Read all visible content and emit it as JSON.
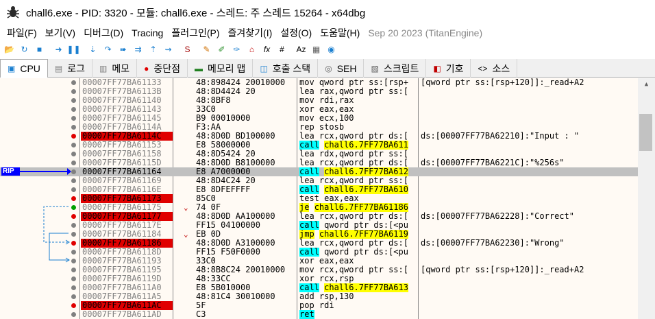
{
  "window": {
    "title": "chall6.exe - PID: 3320 - 모듈: chall6.exe - 스레드: 주 스레드 15264 - x64dbg"
  },
  "menu": [
    "파일(F)",
    "보기(V)",
    "디버그(D)",
    "Tracing",
    "플러그인(P)",
    "즐겨찾기(I)",
    "설정(O)",
    "도움말(H)"
  ],
  "build": "Sep 20 2023 (TitanEngine)",
  "toolbar_icons": [
    "open-icon",
    "restart-icon",
    "stop-icon",
    "run-icon",
    "pause-icon",
    "step-into-icon",
    "step-over-icon",
    "trace-into-icon",
    "trace-over-icon",
    "execute-till-return-icon",
    "run-to-user-code-icon",
    "scylla-icon",
    "patch-icon",
    "comment-icon",
    "label-icon",
    "bookmark-icon",
    "function-icon",
    "hash-icon",
    "strings-icon",
    "calculator-icon",
    "globe-icon"
  ],
  "tabs": [
    {
      "label": "CPU",
      "icon": "cpu-icon"
    },
    {
      "label": "로그",
      "icon": "log-icon"
    },
    {
      "label": "메모",
      "icon": "notes-icon"
    },
    {
      "label": "중단점",
      "icon": "breakpoint-icon"
    },
    {
      "label": "메모리 맵",
      "icon": "memory-map-icon"
    },
    {
      "label": "호출 스택",
      "icon": "call-stack-icon"
    },
    {
      "label": "SEH",
      "icon": "seh-icon"
    },
    {
      "label": "스크립트",
      "icon": "script-icon"
    },
    {
      "label": "기호",
      "icon": "symbols-icon"
    },
    {
      "label": "소스",
      "icon": "source-icon"
    }
  ],
  "rip_label": "RIP",
  "colors": {
    "breakpoint": "#e00000",
    "rip_row": "#c0c0c0",
    "call_highlight": "#00ffff",
    "jump_highlight": "#ffff00"
  },
  "rows": [
    {
      "addr": "00007FF77BA61133",
      "bytes": "48:898424 20010000",
      "mn": "mov",
      "ops": "qword ptr ss:[rsp+",
      "comment": "[qword ptr ss:[rsp+120]]:_read+A2",
      "bp": "gray"
    },
    {
      "addr": "00007FF77BA6113B",
      "bytes": "48:8D4424 20",
      "mn": "lea",
      "ops": "rax,qword ptr ss:[",
      "comment": "",
      "bp": "gray"
    },
    {
      "addr": "00007FF77BA61140",
      "bytes": "48:8BF8",
      "mn": "mov",
      "ops": "rdi,rax",
      "comment": "",
      "bp": "gray"
    },
    {
      "addr": "00007FF77BA61143",
      "bytes": "33C0",
      "mn": "xor",
      "ops": "eax,eax",
      "comment": "",
      "bp": "gray"
    },
    {
      "addr": "00007FF77BA61145",
      "bytes": "B9 00010000",
      "mn": "mov",
      "ops": "ecx,100",
      "comment": "",
      "bp": "gray"
    },
    {
      "addr": "00007FF77BA6114A",
      "bytes": "F3:AA",
      "mn": "rep",
      "ops": "stosb",
      "comment": "",
      "bp": "gray"
    },
    {
      "addr": "00007FF77BA6114C",
      "bytes": "48:8D0D BD100000",
      "mn": "lea",
      "ops": "rcx,qword ptr ds:[",
      "comment": "ds:[00007FF77BA62210]:\"Input : \"",
      "bp": "red",
      "hit": true
    },
    {
      "addr": "00007FF77BA61153",
      "bytes": "E8 58000000",
      "mn": "call",
      "ops": "chall6.7FF77BA611",
      "comment": "",
      "bp": "gray",
      "kind": "call"
    },
    {
      "addr": "00007FF77BA61158",
      "bytes": "48:8D5424 20",
      "mn": "lea",
      "ops": "rdx,qword ptr ss:[",
      "comment": "",
      "bp": "gray"
    },
    {
      "addr": "00007FF77BA6115D",
      "bytes": "48:8D0D B8100000",
      "mn": "lea",
      "ops": "rcx,qword ptr ds:[",
      "comment": "ds:[00007FF77BA6221C]:\"%256s\"",
      "bp": "gray"
    },
    {
      "addr": "00007FF77BA61164",
      "bytes": "E8 A7000000",
      "mn": "call",
      "ops": "chall6.7FF77BA612",
      "comment": "",
      "bp": "gray",
      "kind": "call",
      "rip": true
    },
    {
      "addr": "00007FF77BA61169",
      "bytes": "48:8D4C24 20",
      "mn": "lea",
      "ops": "rcx,qword ptr ss:[",
      "comment": "",
      "bp": "gray"
    },
    {
      "addr": "00007FF77BA6116E",
      "bytes": "E8 8DFEFFFF",
      "mn": "call",
      "ops": "chall6.7FF77BA610",
      "comment": "",
      "bp": "gray",
      "kind": "call"
    },
    {
      "addr": "00007FF77BA61173",
      "bytes": "85C0",
      "mn": "test",
      "ops": "eax,eax",
      "comment": "",
      "bp": "red",
      "hit": true
    },
    {
      "addr": "00007FF77BA61175",
      "bytes": "74 0F",
      "mn": "je",
      "ops": "chall6.7FF77BA61186",
      "comment": "",
      "bp": "green",
      "kind": "jmp",
      "arrow": "v"
    },
    {
      "addr": "00007FF77BA61177",
      "bytes": "48:8D0D AA100000",
      "mn": "lea",
      "ops": "rcx,qword ptr ds:[",
      "comment": "ds:[00007FF77BA62228]:\"Correct\"",
      "bp": "red",
      "hit": true
    },
    {
      "addr": "00007FF77BA6117E",
      "bytes": "FF15 04100000",
      "mn": "call",
      "ops": "qword ptr ds:[<pu",
      "comment": "",
      "bp": "gray",
      "kind": "call"
    },
    {
      "addr": "00007FF77BA61184",
      "bytes": "EB 0D",
      "mn": "jmp",
      "ops": "chall6.7FF77BA6119",
      "comment": "",
      "bp": "gray",
      "kind": "jmp",
      "arrow": "v"
    },
    {
      "addr": "00007FF77BA61186",
      "bytes": "48:8D0D A3100000",
      "mn": "lea",
      "ops": "rcx,qword ptr ds:[",
      "comment": "ds:[00007FF77BA62230]:\"Wrong\"",
      "bp": "red",
      "hit": true
    },
    {
      "addr": "00007FF77BA6118D",
      "bytes": "FF15 F50F0000",
      "mn": "call",
      "ops": "qword ptr ds:[<pu",
      "comment": "",
      "bp": "gray",
      "kind": "call"
    },
    {
      "addr": "00007FF77BA61193",
      "bytes": "33C0",
      "mn": "xor",
      "ops": "eax,eax",
      "comment": "",
      "bp": "gray"
    },
    {
      "addr": "00007FF77BA61195",
      "bytes": "48:8B8C24 20010000",
      "mn": "mov",
      "ops": "rcx,qword ptr ss:[",
      "comment": "[qword ptr ss:[rsp+120]]:_read+A2",
      "bp": "gray"
    },
    {
      "addr": "00007FF77BA6119D",
      "bytes": "48:33CC",
      "mn": "xor",
      "ops": "rcx,rsp",
      "comment": "",
      "bp": "gray"
    },
    {
      "addr": "00007FF77BA611A0",
      "bytes": "E8 5B010000",
      "mn": "call",
      "ops": "chall6.7FF77BA613",
      "comment": "",
      "bp": "gray",
      "kind": "call"
    },
    {
      "addr": "00007FF77BA611A5",
      "bytes": "48:81C4 30010000",
      "mn": "add",
      "ops": "rsp,130",
      "comment": "",
      "bp": "gray"
    },
    {
      "addr": "00007FF77BA611AC",
      "bytes": "5F",
      "mn": "pop",
      "ops": "rdi",
      "comment": "",
      "bp": "red",
      "hit": true
    },
    {
      "addr": "00007FF77BA611AD",
      "bytes": "C3",
      "mn": "ret",
      "ops": "",
      "comment": "",
      "bp": "gray",
      "kind": "ret"
    }
  ]
}
